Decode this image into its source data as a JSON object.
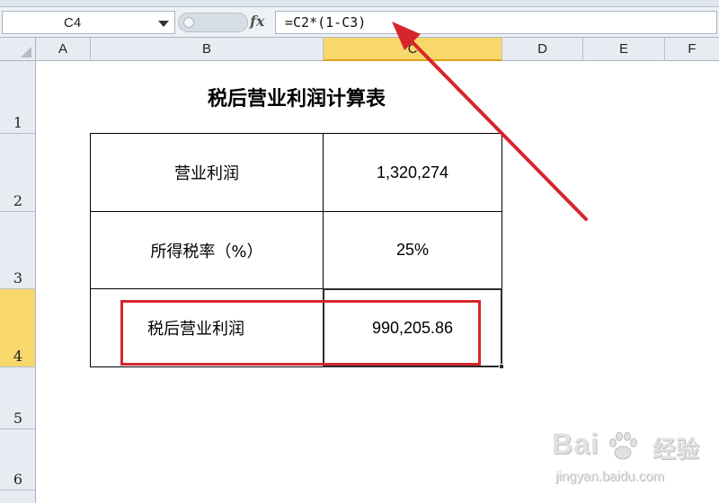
{
  "formula_bar": {
    "name_box": "C4",
    "fx_label": "fx",
    "formula": "=C2*(1-C3)"
  },
  "columns": [
    {
      "label": "A",
      "active": false
    },
    {
      "label": "B",
      "active": false
    },
    {
      "label": "C",
      "active": true
    },
    {
      "label": "D",
      "active": false
    },
    {
      "label": "E",
      "active": false
    },
    {
      "label": "F",
      "active": false
    }
  ],
  "rows": [
    {
      "label": "1",
      "active": false
    },
    {
      "label": "2",
      "active": false
    },
    {
      "label": "3",
      "active": false
    },
    {
      "label": "4",
      "active": true
    },
    {
      "label": "5",
      "active": false
    },
    {
      "label": "6",
      "active": false
    }
  ],
  "sheet": {
    "title": "税后营业利润计算表",
    "table": [
      {
        "label": "营业利润",
        "value": "1,320,274"
      },
      {
        "label": "所得税率（%）",
        "value": "25%"
      },
      {
        "label": "税后营业利润",
        "value": "990,205.86"
      }
    ]
  },
  "annotation": {
    "color": "#d6262c"
  },
  "watermark": {
    "brand": "Bai",
    "brand2": "经验",
    "url": "jingyan.baidu.com"
  }
}
